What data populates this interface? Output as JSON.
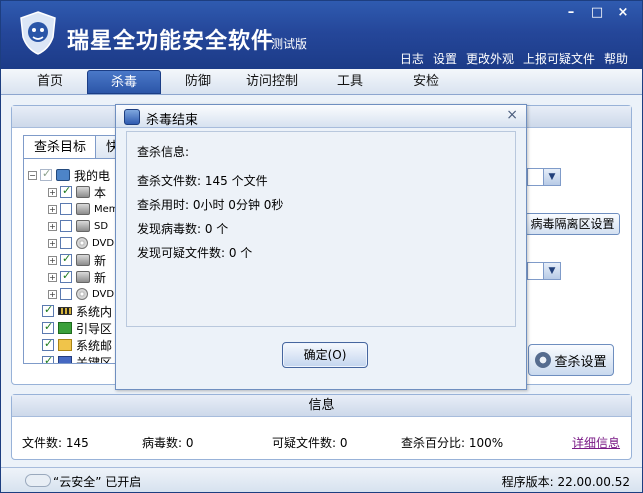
{
  "app": {
    "title": "瑞星全功能安全软件",
    "subtitle": "测试版",
    "window_buttons": [
      "–",
      "□",
      "×"
    ],
    "top_links": [
      "日志",
      "设置",
      "更改外观",
      "上报可疑文件",
      "帮助"
    ]
  },
  "nav": {
    "tabs": [
      "首页",
      "杀毒",
      "防御",
      "访问控制",
      "工具",
      "安检"
    ],
    "active": "杀毒"
  },
  "scan": {
    "subtabs": [
      "查杀目标",
      "快"
    ],
    "tree": [
      {
        "label": "我的电",
        "icon": "pc-icon",
        "checked": true,
        "dim": true
      },
      {
        "label": "本",
        "icon": "drive-icon",
        "checked": true
      },
      {
        "label": "Mem",
        "icon": "drive-icon",
        "checked": false
      },
      {
        "label": "SD",
        "icon": "drive-icon",
        "checked": false
      },
      {
        "label": "DVD",
        "icon": "cd-icon",
        "checked": false
      },
      {
        "label": "新",
        "icon": "drive-icon",
        "checked": true
      },
      {
        "label": "新",
        "icon": "drive-icon",
        "checked": true
      },
      {
        "label": "DVD",
        "icon": "cd-icon",
        "checked": false
      },
      {
        "label": "系统内",
        "icon": "memory-icon",
        "checked": true
      },
      {
        "label": "引导区",
        "icon": "boot-icon",
        "checked": true
      },
      {
        "label": "系统邮",
        "icon": "mail-icon",
        "checked": true
      },
      {
        "label": "关键区",
        "icon": "key-icon",
        "checked": true
      }
    ],
    "quarantine_button": "病毒隔离区设置",
    "scan_settings_button": "查杀设置"
  },
  "dialog": {
    "title": "杀毒结束",
    "close": "×",
    "heading": "查杀信息:",
    "lines": [
      "查杀文件数:  145 个文件",
      "查杀用时: 0小时 0分钟 0秒",
      "发现病毒数:   0 个",
      "发现可疑文件数:   0 个"
    ],
    "ok_button": "确定(O)"
  },
  "info": {
    "header": "信息",
    "file_count": "文件数: 145",
    "virus_count": "病毒数: 0",
    "suspicious_count": "可疑文件数: 0",
    "scan_percent": "查杀百分比: 100%",
    "detail_link": "详细信息"
  },
  "status": {
    "cloud": "“云安全” 已开启",
    "version": "程序版本: 22.00.00.52"
  }
}
